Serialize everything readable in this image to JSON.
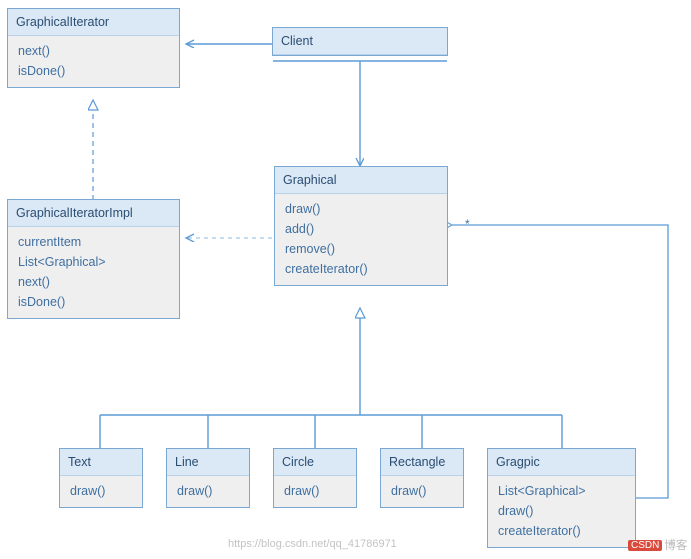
{
  "diagram": {
    "type": "uml-class-diagram",
    "colors": {
      "line": "#5b9bd5",
      "title_bg": "#dbe8f5",
      "body_bg": "#efefef",
      "text": "#3f6fa0",
      "title_text": "#2a4d73",
      "border": "#7aa8d2"
    },
    "classes": [
      {
        "id": "graphical-iterator",
        "title": "GraphicalIterator",
        "members": [
          "next()",
          "isDone()"
        ]
      },
      {
        "id": "client",
        "title": "Client",
        "members": []
      },
      {
        "id": "graphical-iterator-impl",
        "title": "GraphicalIteratorImpl",
        "members": [
          "currentItem",
          "List<Graphical>",
          "next()",
          "isDone()"
        ]
      },
      {
        "id": "graphical",
        "title": "Graphical",
        "members": [
          "draw()",
          "add()",
          "remove()",
          "createIterator()"
        ]
      },
      {
        "id": "text",
        "title": "Text",
        "members": [
          "draw()"
        ]
      },
      {
        "id": "line",
        "title": "Line",
        "members": [
          "draw()"
        ]
      },
      {
        "id": "circle",
        "title": "Circle",
        "members": [
          "draw()"
        ]
      },
      {
        "id": "rectangle",
        "title": "Rectangle",
        "members": [
          "draw()"
        ]
      },
      {
        "id": "gragpic",
        "title": "Gragpic",
        "members": [
          "List<Graphical>",
          "draw()",
          "createIterator()"
        ]
      }
    ],
    "labels": {
      "multiplicity_star": "*"
    },
    "watermarks": {
      "url": "https://blog.csdn.net/qq_41786971",
      "site": "CSDN",
      "site_suffix": "博客"
    }
  }
}
